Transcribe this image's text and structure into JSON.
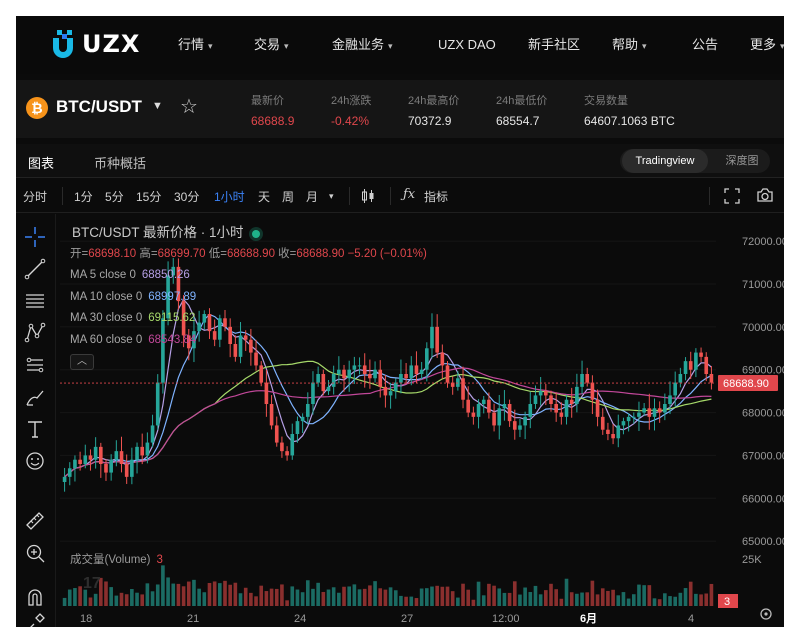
{
  "nav": {
    "logo": "UZX",
    "items": [
      {
        "label": "行情",
        "dropdown": true
      },
      {
        "label": "交易",
        "dropdown": true
      },
      {
        "label": "金融业务",
        "dropdown": true
      },
      {
        "label": "UZX DAO",
        "dropdown": false
      },
      {
        "label": "新手社区",
        "dropdown": false
      },
      {
        "label": "帮助",
        "dropdown": true
      },
      {
        "label": "公告",
        "dropdown": false
      },
      {
        "label": "更多",
        "dropdown": true
      }
    ]
  },
  "ticker": {
    "coin_icon": "bitcoin-icon",
    "pair": "BTC/USDT",
    "stats": [
      {
        "label": "最新价",
        "value": "68688.9",
        "color": "red"
      },
      {
        "label": "24h涨跌",
        "value": "-0.42%",
        "color": "red"
      },
      {
        "label": "24h最高价",
        "value": "70372.9",
        "color": "white"
      },
      {
        "label": "24h最低价",
        "value": "68554.7",
        "color": "white"
      },
      {
        "label": "交易数量",
        "value": "64607.1063 BTC",
        "color": "white"
      }
    ]
  },
  "tabs": {
    "chart": "图表",
    "overview": "币种概括",
    "views": [
      "Tradingview",
      "深度图"
    ],
    "active_view": "Tradingview"
  },
  "toolbar": {
    "intervals": [
      "分时",
      "1分",
      "5分",
      "15分",
      "30分",
      "1小时",
      "天",
      "周",
      "月"
    ],
    "active_interval": "1小时",
    "indicators_label": "指标"
  },
  "legend": {
    "title": "BTC/USDT 最新价格 · 1小时",
    "ohlc": {
      "o_label": "开=",
      "o": "68698.10",
      "h_label": "高=",
      "h": "68699.70",
      "l_label": "低=",
      "l": "68688.90",
      "c_label": "收=",
      "c": "68688.90",
      "change": "−5.20 (−0.01%)"
    },
    "ma": [
      {
        "label": "MA 5 close 0",
        "value": "68850.26",
        "color": "#b6a0e6"
      },
      {
        "label": "MA 10 close 0",
        "value": "68997.89",
        "color": "#7fb3ff"
      },
      {
        "label": "MA 30 close 0",
        "value": "69115.62",
        "color": "#a6d96a"
      },
      {
        "label": "MA 60 close 0",
        "value": "68543.84",
        "color": "#c2489a"
      }
    ],
    "volume_label": "成交量(Volume)",
    "volume_value": "3"
  },
  "axes": {
    "y_ticks": [
      "72000.00",
      "71000.00",
      "70000.00",
      "69000.00",
      "68000.00",
      "67000.00",
      "66000.00",
      "65000.00"
    ],
    "last_price_tag": "68688.90",
    "volume_ticks": [
      "25K"
    ],
    "volume_tag": "3",
    "x_ticks": [
      "18",
      "21",
      "24",
      "27",
      "12:00",
      "6月",
      "4"
    ]
  },
  "chart_data": {
    "type": "candlestick",
    "pair": "BTC/USDT",
    "interval": "1小时",
    "ylim": [
      64700,
      72400
    ],
    "last_price": 68688.9,
    "closes": [
      66500,
      66700,
      66900,
      66800,
      67000,
      66900,
      67200,
      66800,
      66600,
      66900,
      67100,
      66800,
      66500,
      66900,
      67200,
      67000,
      67300,
      67700,
      68700,
      70200,
      71200,
      71400,
      70600,
      69800,
      69500,
      69900,
      70100,
      70300,
      69900,
      69700,
      70200,
      70000,
      69600,
      69300,
      69800,
      69700,
      69400,
      69100,
      68700,
      68200,
      67700,
      67300,
      67100,
      67000,
      67500,
      67800,
      67900,
      68200,
      68700,
      68900,
      68500,
      68600,
      68900,
      69000,
      68800,
      69000,
      69100,
      69100,
      68900,
      68800,
      69000,
      68600,
      68400,
      68500,
      68700,
      68900,
      68800,
      69100,
      68900,
      69000,
      69500,
      70000,
      69400,
      69100,
      68700,
      68600,
      68800,
      68300,
      68000,
      67900,
      68200,
      68300,
      68000,
      67700,
      68100,
      68200,
      67800,
      67600,
      67700,
      67900,
      68200,
      68400,
      68500,
      68400,
      68200,
      68000,
      67900,
      68300,
      68200,
      68600,
      68900,
      68700,
      68300,
      67900,
      67600,
      67500,
      67400,
      67700,
      67800,
      67900,
      67900,
      68000,
      68100,
      67900,
      68100,
      68000,
      68200,
      68400,
      68700,
      68900,
      69200,
      69000,
      69400,
      69300,
      68900,
      68700
    ]
  }
}
